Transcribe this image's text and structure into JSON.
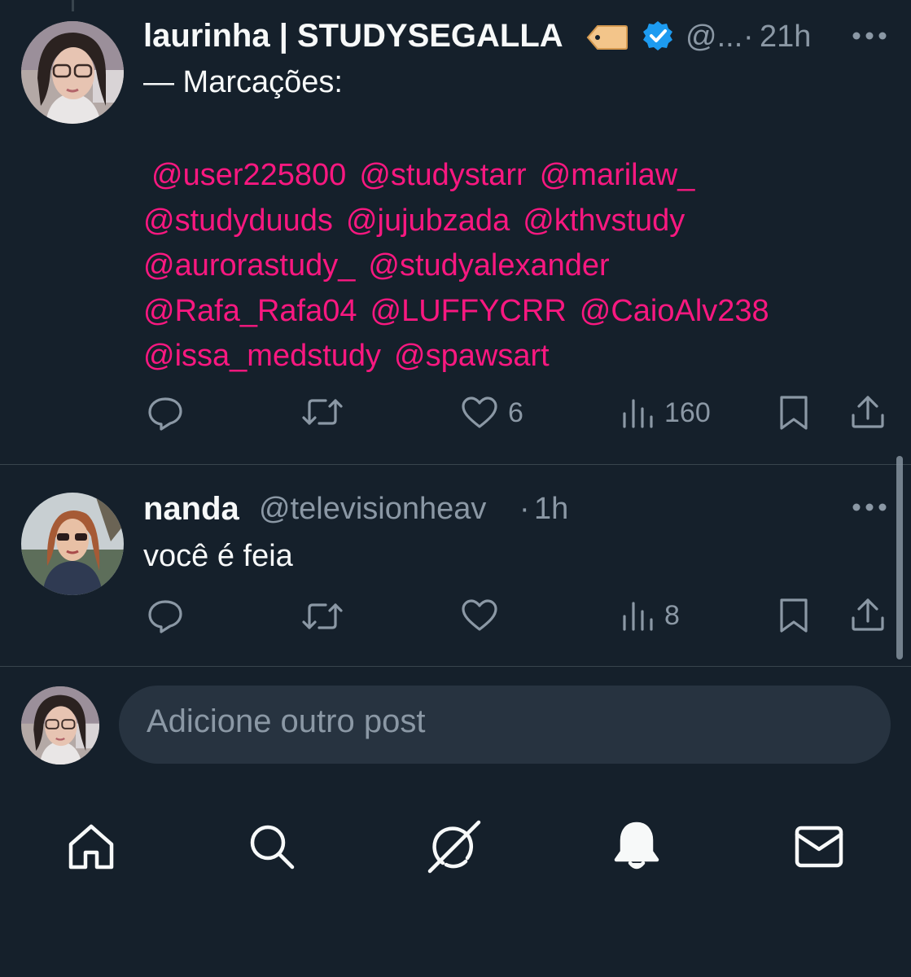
{
  "colors": {
    "background": "#15202b",
    "mention": "#f91880",
    "secondary_text": "#8b98a5",
    "verified": "#1d9bf0",
    "composer_bg": "#273340"
  },
  "posts": [
    {
      "display_name": "laurinha | STUDYSEGALLA",
      "name_emoji": "🏷️",
      "verified": true,
      "handle": "@...",
      "separator": "·",
      "time": "21h",
      "more_icon": "more-dots-icon",
      "text": "— Marcações:",
      "mention_rows": [
        [
          "@user225800",
          "@studystarr",
          "@marilaw_"
        ],
        [
          "@studyduuds",
          "@jujubzada",
          "@kthvstudy"
        ],
        [
          "@aurorastudy_",
          "@studyalexander"
        ],
        [
          "@Rafa_Rafa04",
          "@LUFFYCRR",
          "@CaioAlv238"
        ],
        [
          "@issa_medstudy",
          "@spawsart"
        ]
      ],
      "actions": {
        "reply": "",
        "repost": "",
        "like": "6",
        "views": "160"
      }
    },
    {
      "display_name": "nanda",
      "verified": false,
      "handle": "@televisionheav",
      "separator": "·",
      "time": "1h",
      "more_icon": "more-dots-icon",
      "text": "você é feia",
      "actions": {
        "reply": "",
        "repost": "",
        "like": "",
        "views": "8"
      }
    }
  ],
  "composer": {
    "placeholder": "Adicione outro post"
  },
  "bottom_nav": [
    {
      "icon": "home-icon"
    },
    {
      "icon": "search-icon"
    },
    {
      "icon": "grok-icon"
    },
    {
      "icon": "notifications-bell-icon"
    },
    {
      "icon": "messages-envelope-icon"
    }
  ]
}
